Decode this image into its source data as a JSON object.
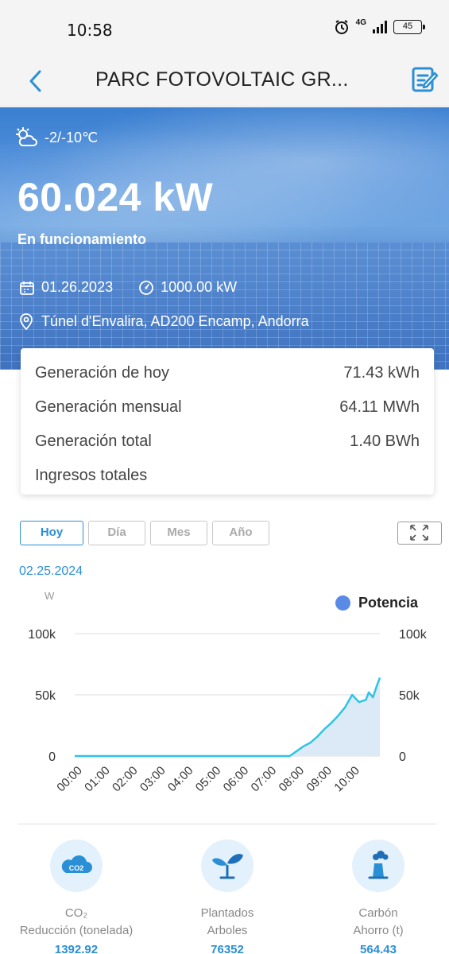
{
  "status_bar": {
    "time": "10:58",
    "network": "4G",
    "battery": "45"
  },
  "header": {
    "title": "PARC FOTOVOLTAIC GR...",
    "back_icon": "chevron-left-icon",
    "edit_icon": "edit-icon"
  },
  "hero": {
    "weather": "-2/-10℃",
    "power": "60.024 kW",
    "status": "En funcionamiento",
    "date": "01.26.2023",
    "capacity": "1000.00 kW",
    "location": "Túnel d'Envalira, AD200 Encamp, Andorra"
  },
  "stats": [
    {
      "label": "Generación de hoy",
      "value": "71.43 kWh"
    },
    {
      "label": "Generación mensual",
      "value": "64.11 MWh"
    },
    {
      "label": "Generación total",
      "value": "1.40 BWh"
    },
    {
      "label": "Ingresos totales",
      "value": ""
    }
  ],
  "tabs": [
    {
      "label": "Hoy",
      "active": true
    },
    {
      "label": "Día",
      "active": false
    },
    {
      "label": "Mes",
      "active": false
    },
    {
      "label": "Año",
      "active": false
    }
  ],
  "chart_date": "02.25.2024",
  "chart_data": {
    "type": "area",
    "y_unit": "W",
    "legend": [
      "Potencia"
    ],
    "series": [
      {
        "name": "Potencia",
        "color": "#2ec4e8"
      }
    ],
    "x_ticks": [
      "00:00",
      "01:00",
      "02:00",
      "03:00",
      "04:00",
      "05:00",
      "06:00",
      "07:00",
      "08:00",
      "09:00",
      "10:00"
    ],
    "y_ticks_left": [
      "100k",
      "50k",
      "0"
    ],
    "y_ticks_right": [
      "100k",
      "50k",
      "0"
    ],
    "ylim": [
      0,
      100000
    ],
    "xlim": [
      0,
      11
    ],
    "x": [
      0,
      1,
      2,
      3,
      4,
      5,
      6,
      7,
      7.75,
      8.0,
      8.25,
      8.5,
      8.75,
      9.0,
      9.25,
      9.5,
      9.75,
      10.0,
      10.25,
      10.5,
      10.6,
      10.75,
      10.9,
      11.0
    ],
    "values": [
      0,
      0,
      0,
      0,
      0,
      0,
      0,
      0,
      0,
      4000,
      8000,
      11000,
      16000,
      22000,
      27000,
      33000,
      40000,
      50000,
      44000,
      46000,
      52000,
      48000,
      58000,
      64000
    ]
  },
  "metrics": [
    {
      "icon": "co2-cloud-icon",
      "label_line1": "CO₂",
      "label_line2": "Reducción (tonelada)",
      "value": "1392.92"
    },
    {
      "icon": "plant-icon",
      "label_line1": "Plantados",
      "label_line2": "Arboles",
      "value": "76352"
    },
    {
      "icon": "power-plant-icon",
      "label_line1": "Carbón",
      "label_line2": "Ahorro (t)",
      "value": "564.43"
    }
  ]
}
